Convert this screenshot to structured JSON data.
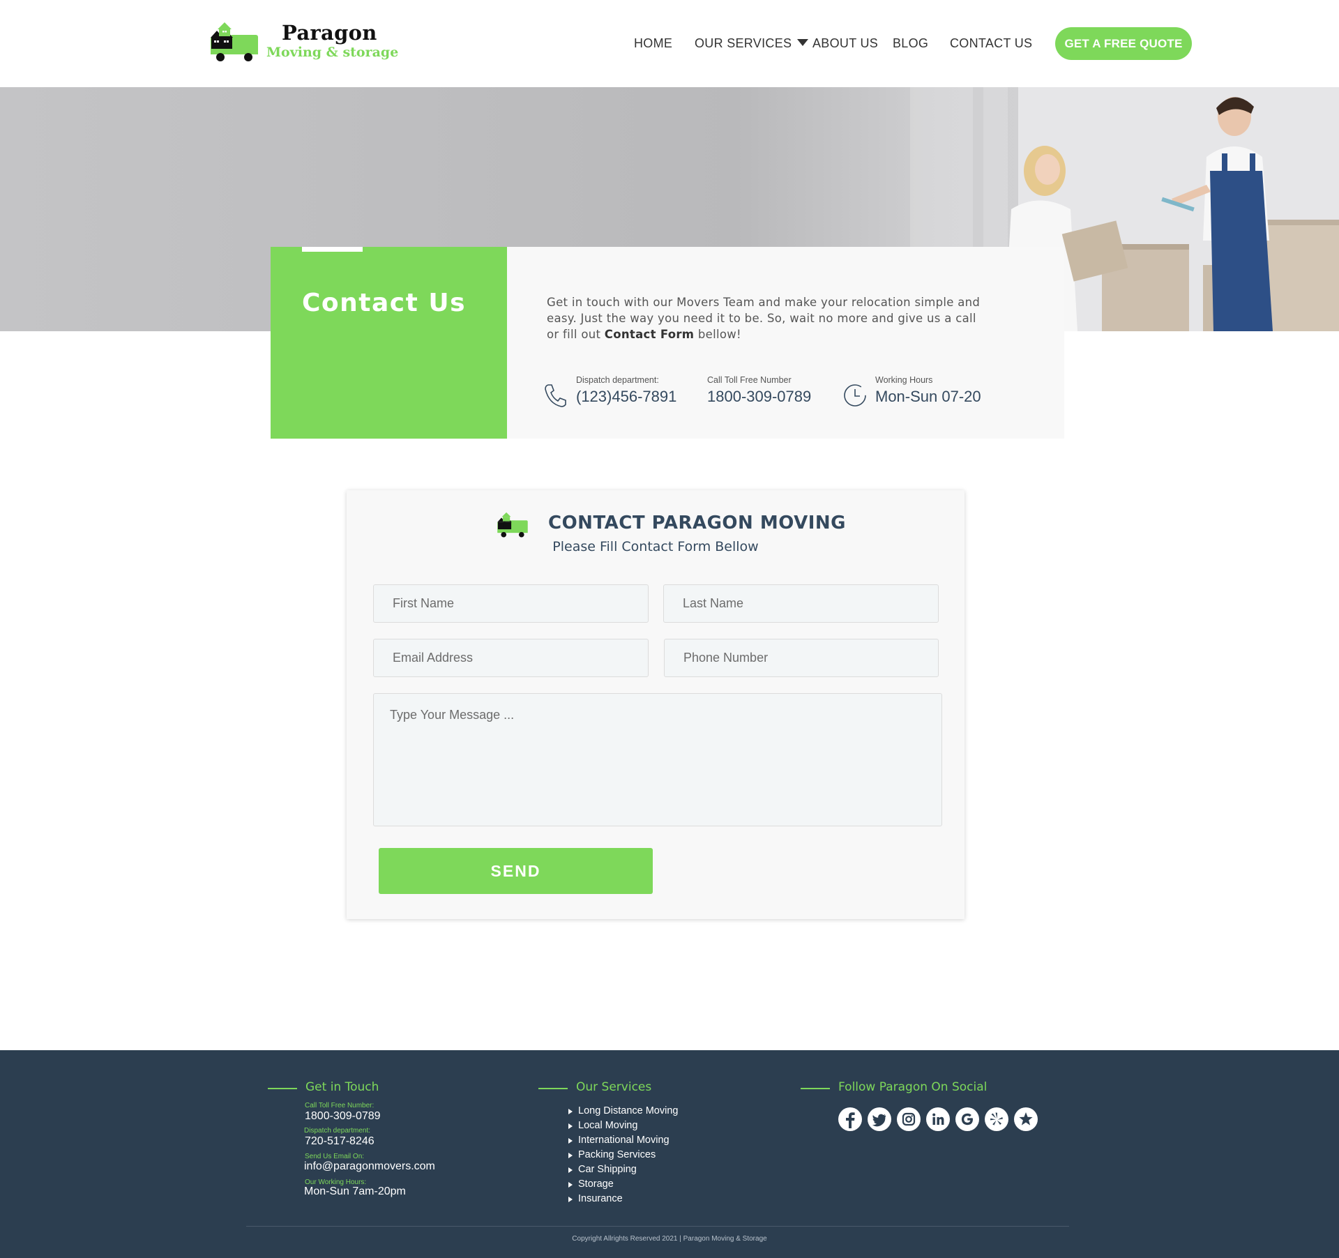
{
  "header": {
    "logo": {
      "title": "Paragon",
      "subtitle": "Moving & storage",
      "icon": "moving-truck-house-icon"
    },
    "nav": {
      "home": "HOME",
      "services": "OUR  SERVICES",
      "about": "ABOUT US",
      "blog": "BLOG",
      "contact": "CONTACT US"
    },
    "cta": "GET A FREE QUOTE"
  },
  "banner": {
    "title": "Contact Us",
    "text_before": "Get in touch with our Movers Team and make your relocation simple and easy. Just the way you need it to be. So, wait no more and give us a call or fill  out ",
    "text_bold": "Contact Form",
    "text_after": " bellow!",
    "dispatch": {
      "label": "Dispatch department:",
      "value": "(123)456-7891",
      "icon": "phone-icon"
    },
    "toll_free": {
      "label": "Call Toll Free Number",
      "value": "1800-309-0789"
    },
    "hours": {
      "label": "Working Hours",
      "value": "Mon-Sun 07-20",
      "icon": "clock-icon"
    }
  },
  "form": {
    "title": "CONTACT  PARAGON MOVING",
    "subtitle": "Please Fill Contact Form Bellow",
    "first_name": {
      "placeholder": "First Name",
      "value": ""
    },
    "last_name": {
      "placeholder": "Last Name",
      "value": ""
    },
    "email": {
      "placeholder": "Email Address",
      "value": ""
    },
    "phone": {
      "placeholder": "Phone Number",
      "value": ""
    },
    "message": {
      "placeholder": "Type Your Message ...",
      "value": ""
    },
    "send": "SEND"
  },
  "footer": {
    "touch": {
      "heading": "Get in Touch",
      "toll_label": "Call Toll Free Number:",
      "toll_value": "1800-309-0789",
      "dispatch_label": "Dispatch department:",
      "dispatch_value": "720-517-8246",
      "email_label": "Send Us Email On:",
      "email_value": "info@paragonmovers.com",
      "hours_label": "Our Working Hours:",
      "hours_value": "Mon-Sun 7am-20pm"
    },
    "services": {
      "heading": "Our Services",
      "items": [
        "Long Distance Moving",
        "Local Moving",
        "International Moving",
        "Packing Services",
        "Car Shipping",
        "Storage",
        "Insurance"
      ]
    },
    "social": {
      "heading": "Follow Paragon On Social",
      "icons": [
        "facebook-icon",
        "twitter-icon",
        "instagram-icon",
        "linkedin-icon",
        "google-icon",
        "yelp-icon",
        "star-review-icon"
      ]
    },
    "copyright": "Copyright Allrights Reserved 2021 | Paragon Moving & Storage"
  },
  "colors": {
    "brand_green": "#7ed85a",
    "navy": "#2c3e50",
    "text_dark": "#34495e"
  }
}
